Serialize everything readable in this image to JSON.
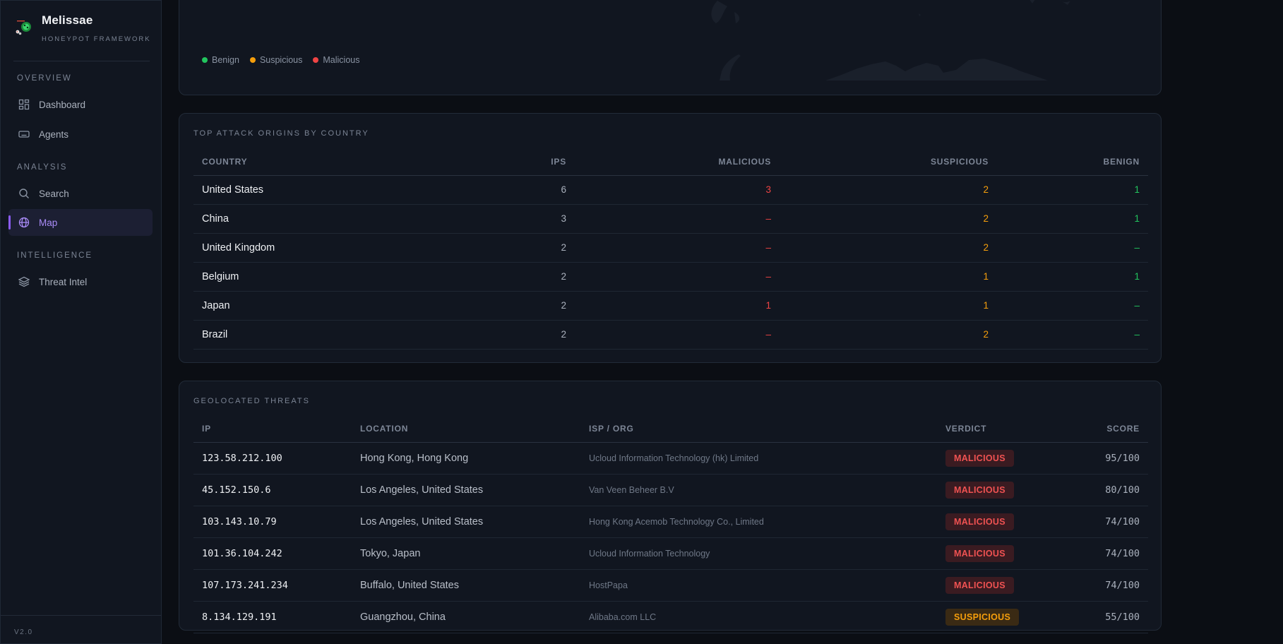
{
  "app": {
    "name": "Melissae",
    "subtitle": "HONEYPOT FRAMEWORK",
    "version": "V2.0"
  },
  "sidebar": {
    "sections": [
      {
        "title": "OVERVIEW",
        "items": [
          {
            "label": "Dashboard",
            "icon": "dashboard-icon"
          },
          {
            "label": "Agents",
            "icon": "agents-icon"
          }
        ]
      },
      {
        "title": "ANALYSIS",
        "items": [
          {
            "label": "Search",
            "icon": "search-icon"
          },
          {
            "label": "Map",
            "icon": "globe-icon",
            "active": true
          }
        ]
      },
      {
        "title": "INTELLIGENCE",
        "items": [
          {
            "label": "Threat Intel",
            "icon": "layers-icon"
          }
        ]
      }
    ]
  },
  "map_card": {
    "legend": [
      {
        "label": "Benign",
        "color": "#22c55e"
      },
      {
        "label": "Suspicious",
        "color": "#f59e0b"
      },
      {
        "label": "Malicious",
        "color": "#ef4444"
      }
    ]
  },
  "origins": {
    "title": "TOP ATTACK ORIGINS BY COUNTRY",
    "columns": {
      "country": "COUNTRY",
      "ips": "IPS",
      "malicious": "MALICIOUS",
      "suspicious": "SUSPICIOUS",
      "benign": "BENIGN"
    },
    "rows": [
      {
        "country": "United States",
        "ips": "6",
        "malicious": "3",
        "suspicious": "2",
        "benign": "1"
      },
      {
        "country": "China",
        "ips": "3",
        "malicious": "–",
        "suspicious": "2",
        "benign": "1"
      },
      {
        "country": "United Kingdom",
        "ips": "2",
        "malicious": "–",
        "suspicious": "2",
        "benign": "–"
      },
      {
        "country": "Belgium",
        "ips": "2",
        "malicious": "–",
        "suspicious": "1",
        "benign": "1"
      },
      {
        "country": "Japan",
        "ips": "2",
        "malicious": "1",
        "suspicious": "1",
        "benign": "–"
      },
      {
        "country": "Brazil",
        "ips": "2",
        "malicious": "–",
        "suspicious": "2",
        "benign": "–"
      }
    ]
  },
  "threats": {
    "title": "GEOLOCATED THREATS",
    "columns": {
      "ip": "IP",
      "location": "LOCATION",
      "isp": "ISP / ORG",
      "verdict": "VERDICT",
      "score": "SCORE"
    },
    "rows": [
      {
        "ip": "123.58.212.100",
        "location": "Hong Kong, Hong Kong",
        "isp": "Ucloud Information Technology (hk) Limited",
        "verdict": "MALICIOUS",
        "verdict_type": "malicious",
        "score": "95/100"
      },
      {
        "ip": "45.152.150.6",
        "location": "Los Angeles, United States",
        "isp": "Van Veen Beheer B.V",
        "verdict": "MALICIOUS",
        "verdict_type": "malicious",
        "score": "80/100"
      },
      {
        "ip": "103.143.10.79",
        "location": "Los Angeles, United States",
        "isp": "Hong Kong Acemob Technology Co., Limited",
        "verdict": "MALICIOUS",
        "verdict_type": "malicious",
        "score": "74/100"
      },
      {
        "ip": "101.36.104.242",
        "location": "Tokyo, Japan",
        "isp": "Ucloud Information Technology",
        "verdict": "MALICIOUS",
        "verdict_type": "malicious",
        "score": "74/100"
      },
      {
        "ip": "107.173.241.234",
        "location": "Buffalo, United States",
        "isp": "HostPapa",
        "verdict": "MALICIOUS",
        "verdict_type": "malicious",
        "score": "74/100"
      },
      {
        "ip": "8.134.129.191",
        "location": "Guangzhou, China",
        "isp": "Alibaba.com LLC",
        "verdict": "SUSPICIOUS",
        "verdict_type": "suspicious",
        "score": "55/100"
      }
    ]
  }
}
